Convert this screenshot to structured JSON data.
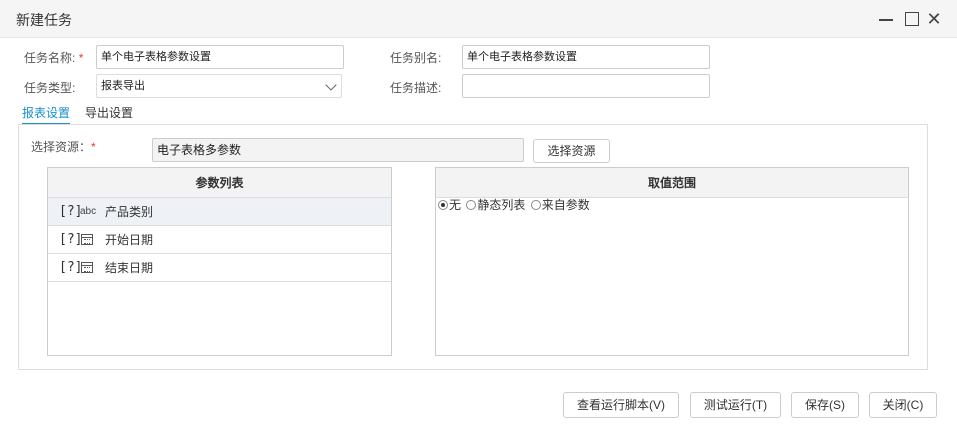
{
  "window": {
    "title": "新建任务",
    "min_icon": "minimize-icon",
    "max_icon": "maximize-icon",
    "close_icon": "close-icon",
    "close_glyph": "✕"
  },
  "form": {
    "task_name_label": "任务名称:",
    "required_mark": "*",
    "task_name_value": "单个电子表格参数设置",
    "task_alias_label": "任务别名:",
    "task_alias_value": "单个电子表格参数设置",
    "task_type_label": "任务类型:",
    "task_type_value": "报表导出",
    "task_desc_label": "任务描述:",
    "task_desc_value": ""
  },
  "tabs": [
    {
      "label": "报表设置",
      "active": true
    },
    {
      "label": "导出设置",
      "active": false
    }
  ],
  "resource": {
    "label": "选择资源：",
    "required_mark": "*",
    "value": "电子表格多参数",
    "select_button": "选择资源"
  },
  "param_list": {
    "header": "参数列表",
    "rows": [
      {
        "marker": "[?]",
        "type": "abc",
        "type_icon": "text-type-icon",
        "name": "产品类别"
      },
      {
        "marker": "[?]",
        "type": "",
        "type_icon": "calendar-icon",
        "name": "开始日期"
      },
      {
        "marker": "[?]",
        "type": "",
        "type_icon": "calendar-icon",
        "name": "结束日期"
      }
    ]
  },
  "value_range": {
    "header": "取值范围",
    "options": [
      {
        "label": "无",
        "checked": true
      },
      {
        "label": "静态列表",
        "checked": false
      },
      {
        "label": "来自参数",
        "checked": false
      }
    ]
  },
  "footer": {
    "view_script": "查看运行脚本(V)",
    "test_run": "测试运行(T)",
    "save": "保存(S)",
    "close": "关闭(C)"
  }
}
